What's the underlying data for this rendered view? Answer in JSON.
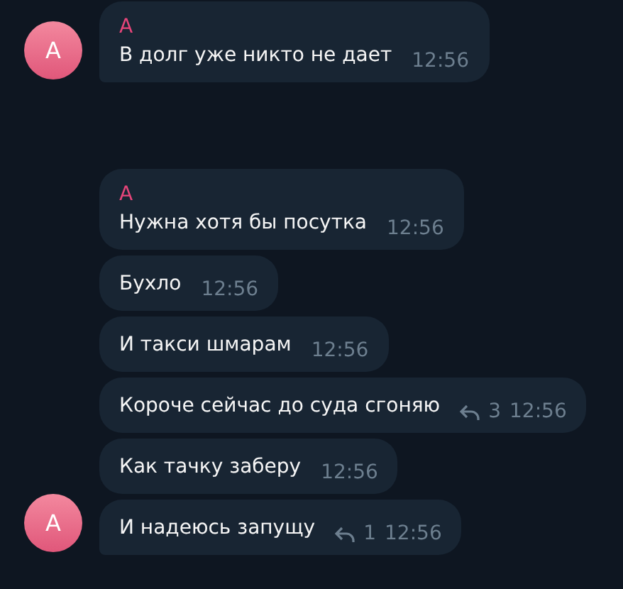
{
  "groups": [
    {
      "sender": "А",
      "avatar_letter": "А",
      "messages": [
        {
          "text": "В долг уже никто не дает",
          "time": "12:56"
        }
      ]
    },
    {
      "sender": "А",
      "avatar_letter": "А",
      "messages": [
        {
          "text": "Нужна хотя бы посутка",
          "time": "12:56"
        },
        {
          "text": "Бухло",
          "time": "12:56"
        },
        {
          "text": "И такси шмарам",
          "time": "12:56"
        },
        {
          "text": "Короче сейчас до суда сгоняю",
          "time": "12:56",
          "replies": "3"
        },
        {
          "text": "Как тачку заберу",
          "time": "12:56"
        },
        {
          "text": "И надеюсь запущу",
          "time": "12:56",
          "replies": "1"
        }
      ]
    }
  ]
}
